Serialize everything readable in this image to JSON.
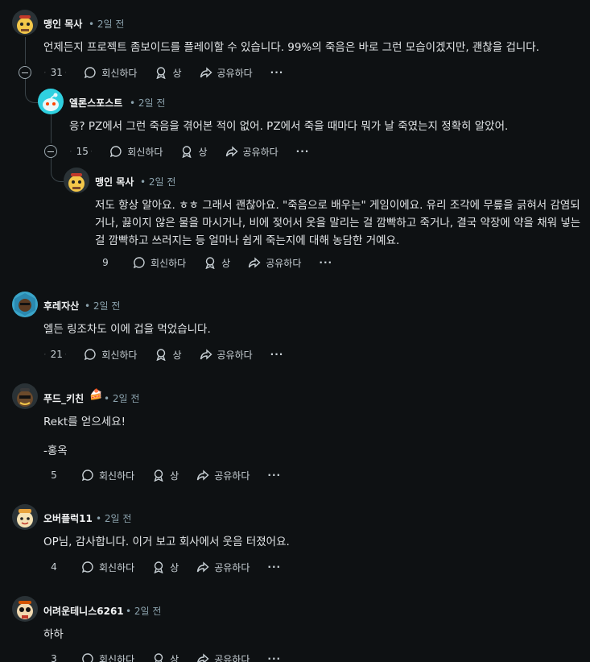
{
  "labels": {
    "reply": "회신하다",
    "award": "상",
    "share": "공유하다",
    "more": "···"
  },
  "comments": [
    {
      "author": "맹인 목사",
      "time": "• 2일 전",
      "lines": [
        "언제든지 프로젝트 좀보이드를 플레이할 수 있습니다. 99%의 죽음은 바로 그런 모습이겠지만, 괜찮을 겁니다."
      ],
      "votes": "31"
    },
    {
      "author": "엘론스포스트",
      "time": "• 2일 전",
      "lines": [
        "응? PZ에서 그런 죽음을 겪어본 적이 없어. PZ에서 죽을 때마다 뭐가 날 죽였는지 정확히 알았어."
      ],
      "votes": "15"
    },
    {
      "author": "맹인 목사",
      "time": "• 2일 전",
      "lines": [
        "저도 항상 알아요. ㅎㅎ 그래서 괜찮아요. \"죽음으로 배우는\" 게임이에요. 유리 조각에 무릎을 긁혀서 감염되",
        "거나, 끓이지 않은 물을 마시거나, 비에 젖어서 옷을 말리는 걸 깜빡하고 죽거나, 결국 약장에 약을 채워 넣는",
        "걸 깜빡하고 쓰러지는 등 얼마나 쉽게 죽는지에 대해 농담한 거예요."
      ],
      "votes": "9"
    },
    {
      "author": "후레자산",
      "time": "• 2일 전",
      "lines": [
        "엘든 링조차도 이에 겁을 먹었습니다."
      ],
      "votes": "21"
    },
    {
      "author": "푸드_키친",
      "time": "• 2일 전",
      "flair": "🍰",
      "lines": [
        "Rekt를 얻으세요!",
        "",
        "-홍옥"
      ],
      "votes": "5"
    },
    {
      "author": "오버플럭11",
      "time": "• 2일 전",
      "lines": [
        "OP님, 감사합니다. 이거 보고 회사에서 웃음 터졌어요."
      ],
      "votes": "4"
    },
    {
      "author": "어려운테니스6261",
      "time": "• 2일 전",
      "lines": [
        "하하"
      ],
      "votes": "3"
    }
  ],
  "colors": {
    "background": "#0e1113",
    "text": "#e3e6e8",
    "meta": "#8ba2ad",
    "thread_line": "#3a4449"
  }
}
